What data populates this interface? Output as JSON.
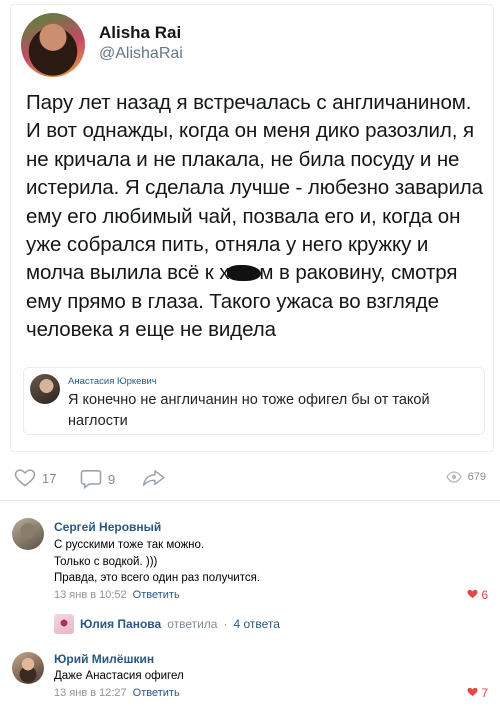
{
  "tweet": {
    "author_name": "Alisha Rai",
    "author_handle": "@AlishaRai",
    "text_before_censor": "Пару лет назад я встречалась с англичанином. И вот однажды, когда он меня дико разозлил, я не кричала и не плакала, не била посуду и не истерила. Я сделала лучше - любезно заварила ему его любимый чай, позвала его и, когда он уже собрался пить, отняла у него кружку и молча вылила всё к х",
    "text_after_censor": "м в раковину, смотря ему прямо в глаза. Такого ужаса во взгляде человека я еще не видела",
    "quoted": {
      "author": "Анастасия Юркевич",
      "text": "Я конечно не англичанин но тоже офигел бы от такой наглости"
    }
  },
  "post_actions": {
    "likes": "17",
    "comments": "9",
    "views": "679"
  },
  "comments": [
    {
      "author": "Сергей Неровный",
      "text": "С русскими тоже так можно.\nТолько с водкой. )))\nПравда, это всего один раз получится.",
      "date": "13 янв в 10:52",
      "reply_label": "Ответить",
      "likes": "6"
    },
    {
      "author": "Юрий Милёшкин",
      "text": "Даже Анастасия офигел",
      "date": "13 янв в 12:27",
      "reply_label": "Ответить",
      "likes": "7"
    }
  ],
  "reply_thread": {
    "author": "Юлия Панова",
    "verb": "ответила",
    "separator": "·",
    "count": "4 ответа"
  },
  "colors": {
    "link_blue": "#2a5885",
    "like_red": "#e64646",
    "muted_gray": "#828a99"
  }
}
